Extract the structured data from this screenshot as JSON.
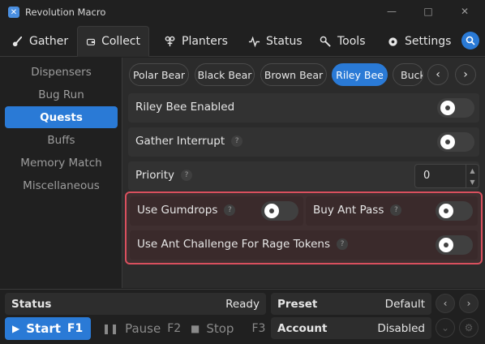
{
  "window": {
    "title": "Revolution Macro",
    "logo": "app-logo",
    "controls": [
      "minimize",
      "maximize",
      "close"
    ]
  },
  "tabs": [
    {
      "label": "Gather",
      "icon": "brush-icon"
    },
    {
      "label": "Collect",
      "icon": "wallet-icon"
    },
    {
      "label": "Planters",
      "icon": "plant-icon"
    },
    {
      "label": "Status",
      "icon": "pulse-icon"
    },
    {
      "label": "Tools",
      "icon": "wrench-icon"
    },
    {
      "label": "Settings",
      "icon": "gear-icon"
    }
  ],
  "active_tab": "Collect",
  "sidebar": {
    "items": [
      {
        "label": "Dispensers"
      },
      {
        "label": "Bug Run"
      },
      {
        "label": "Quests"
      },
      {
        "label": "Buffs"
      },
      {
        "label": "Memory Match"
      },
      {
        "label": "Miscellaneous"
      }
    ],
    "active": "Quests"
  },
  "quest_tabs": {
    "items": [
      "Polar Bear",
      "Black Bear",
      "Brown Bear",
      "Riley Bee",
      "Bucko Bee"
    ],
    "active": "Riley Bee"
  },
  "settings": {
    "riley_enabled": {
      "label": "Riley Bee Enabled",
      "on": false
    },
    "gather_interrupt": {
      "label": "Gather Interrupt",
      "help": "?",
      "on": false
    },
    "priority": {
      "label": "Priority",
      "help": "?",
      "value": "0"
    },
    "use_gumdrops": {
      "label": "Use Gumdrops",
      "help": "?",
      "on": false
    },
    "buy_ant_pass": {
      "label": "Buy Ant Pass",
      "help": "?",
      "on": false
    },
    "ant_challenge": {
      "label": "Use Ant Challenge For Rage Tokens",
      "help": "?",
      "on": false
    }
  },
  "bottom": {
    "status": {
      "label": "Status",
      "value": "Ready"
    },
    "preset": {
      "label": "Preset",
      "value": "Default"
    },
    "account": {
      "label": "Account",
      "value": "Disabled"
    },
    "start": {
      "label": "Start",
      "key": "F1"
    },
    "pause": {
      "label": "Pause",
      "key": "F2"
    },
    "stop": {
      "label": "Stop",
      "key": "F3"
    }
  },
  "colors": {
    "accent": "#2a7ad6",
    "highlight": "#d9505e",
    "background": "#202020",
    "panel": "#2b2b2b"
  }
}
